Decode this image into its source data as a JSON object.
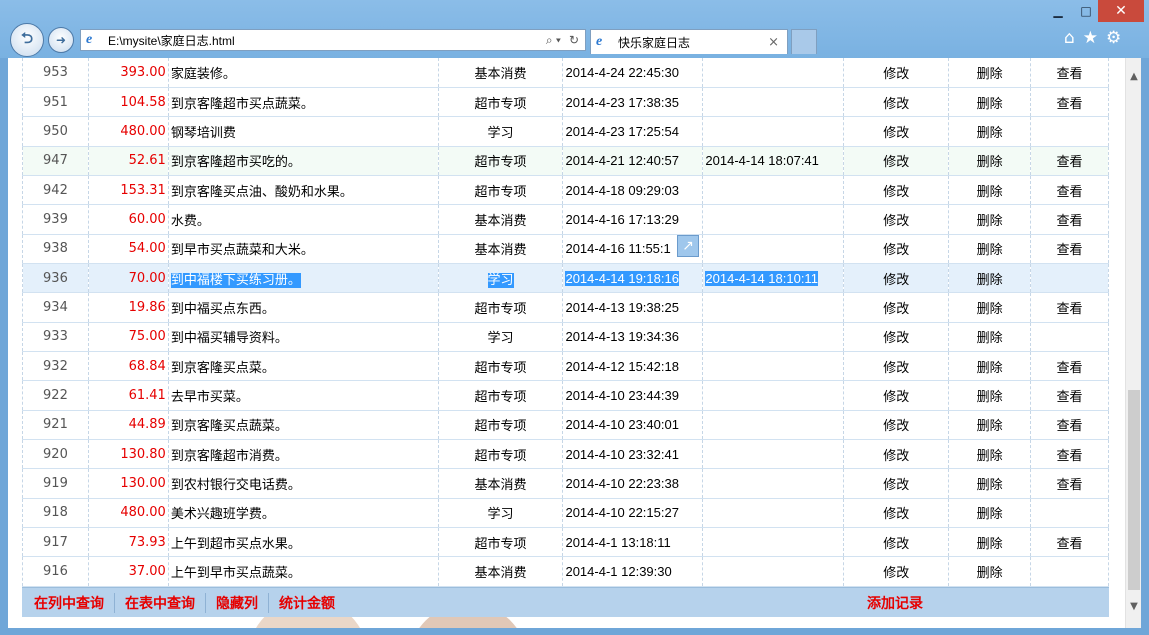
{
  "window": {
    "minimize_glyph": "▁",
    "maximize_glyph": "□",
    "close_glyph": "✕"
  },
  "nav": {
    "back_icon": "arrow-left",
    "forward_icon": "arrow-right",
    "back_glyph": "⮌",
    "forward_glyph": "➜"
  },
  "address_bar": {
    "url": "E:\\mysite\\家庭日志.html",
    "search_glyph": "⌕ ▾",
    "refresh_glyph": "↻"
  },
  "tab": {
    "title": "快乐家庭日志",
    "close_glyph": "×"
  },
  "toolbar": {
    "home_glyph": "⌂",
    "favorites_glyph": "★",
    "settings_glyph": "⚙"
  },
  "colors": {
    "amount_red": "#e60000",
    "selection_blue": "#3399ff",
    "footer_bg": "#b6d2ec",
    "chrome_blue": "#79b1e1"
  },
  "table": {
    "action_labels": {
      "edit": "修改",
      "delete": "删除",
      "view": "查看"
    },
    "rows": [
      {
        "id": "953",
        "amount": "393.00",
        "desc": "家庭装修。",
        "category": "基本消费",
        "time1": "2014-4-24 22:45:30",
        "time2": "",
        "edit": "修改",
        "delete": "删除",
        "view": "查看"
      },
      {
        "id": "951",
        "amount": "104.58",
        "desc": "到京客隆超市买点蔬菜。",
        "category": "超市专项",
        "time1": "2014-4-23 17:38:35",
        "time2": "",
        "edit": "修改",
        "delete": "删除",
        "view": "查看"
      },
      {
        "id": "950",
        "amount": "480.00",
        "desc": "钢琴培训费",
        "category": "学习",
        "time1": "2014-4-23 17:25:54",
        "time2": "",
        "edit": "修改",
        "delete": "删除",
        "view": ""
      },
      {
        "id": "947",
        "amount": "52.61",
        "desc": "到京客隆超市买吃的。",
        "category": "超市专项",
        "time1": "2014-4-21 12:40:57",
        "time2": "2014-4-14 18:07:41",
        "edit": "修改",
        "delete": "删除",
        "view": "查看"
      },
      {
        "id": "942",
        "amount": "153.31",
        "desc": "到京客隆买点油、酸奶和水果。",
        "category": "超市专项",
        "time1": "2014-4-18 09:29:03",
        "time2": "",
        "edit": "修改",
        "delete": "删除",
        "view": "查看"
      },
      {
        "id": "939",
        "amount": "60.00",
        "desc": "水费。",
        "category": "基本消费",
        "time1": "2014-4-16 17:13:29",
        "time2": "",
        "edit": "修改",
        "delete": "删除",
        "view": "查看"
      },
      {
        "id": "938",
        "amount": "54.00",
        "desc": "到早市买点蔬菜和大米。",
        "category": "基本消费",
        "time1": "2014-4-16 11:55:1",
        "time2": "",
        "edit": "修改",
        "delete": "删除",
        "view": "查看"
      },
      {
        "id": "936",
        "amount": "70.00",
        "desc": "到中福楼下买练习册。",
        "category": "学习",
        "time1": "2014-4-14 19:18:16",
        "time2": "2014-4-14 18:10:11",
        "edit": "修改",
        "delete": "删除",
        "view": ""
      },
      {
        "id": "934",
        "amount": "19.86",
        "desc": "到中福买点东西。",
        "category": "超市专项",
        "time1": "2014-4-13 19:38:25",
        "time2": "",
        "edit": "修改",
        "delete": "删除",
        "view": "查看"
      },
      {
        "id": "933",
        "amount": "75.00",
        "desc": "到中福买辅导资料。",
        "category": "学习",
        "time1": "2014-4-13 19:34:36",
        "time2": "",
        "edit": "修改",
        "delete": "删除",
        "view": ""
      },
      {
        "id": "932",
        "amount": "68.84",
        "desc": "到京客隆买点菜。",
        "category": "超市专项",
        "time1": "2014-4-12 15:42:18",
        "time2": "",
        "edit": "修改",
        "delete": "删除",
        "view": "查看"
      },
      {
        "id": "922",
        "amount": "61.41",
        "desc": "去早市买菜。",
        "category": "超市专项",
        "time1": "2014-4-10 23:44:39",
        "time2": "",
        "edit": "修改",
        "delete": "删除",
        "view": "查看"
      },
      {
        "id": "921",
        "amount": "44.89",
        "desc": "到京客隆买点蔬菜。",
        "category": "超市专项",
        "time1": "2014-4-10 23:40:01",
        "time2": "",
        "edit": "修改",
        "delete": "删除",
        "view": "查看"
      },
      {
        "id": "920",
        "amount": "130.80",
        "desc": "到京客隆超市消费。",
        "category": "超市专项",
        "time1": "2014-4-10 23:32:41",
        "time2": "",
        "edit": "修改",
        "delete": "删除",
        "view": "查看"
      },
      {
        "id": "919",
        "amount": "130.00",
        "desc": "到农村银行交电话费。",
        "category": "基本消费",
        "time1": "2014-4-10 22:23:38",
        "time2": "",
        "edit": "修改",
        "delete": "删除",
        "view": "查看"
      },
      {
        "id": "918",
        "amount": "480.00",
        "desc": "美术兴趣班学费。",
        "category": "学习",
        "time1": "2014-4-10 22:15:27",
        "time2": "",
        "edit": "修改",
        "delete": "删除",
        "view": ""
      },
      {
        "id": "917",
        "amount": "73.93",
        "desc": "上午到超市买点水果。",
        "category": "超市专项",
        "time1": "2014-4-1 13:18:11",
        "time2": "",
        "edit": "修改",
        "delete": "删除",
        "view": "查看"
      },
      {
        "id": "916",
        "amount": "37.00",
        "desc": "上午到早市买点蔬菜。",
        "category": "基本消费",
        "time1": "2014-4-1 12:39:30",
        "time2": "",
        "edit": "修改",
        "delete": "删除",
        "view": ""
      }
    ]
  },
  "footer": {
    "search_column": "在列中查询",
    "search_table": "在表中查询",
    "hide_column": "隐藏列",
    "sum_amount": "统计金额",
    "add_record": "添加记录"
  },
  "scrollbar": {
    "up_glyph": "▲",
    "down_glyph": "▼"
  }
}
